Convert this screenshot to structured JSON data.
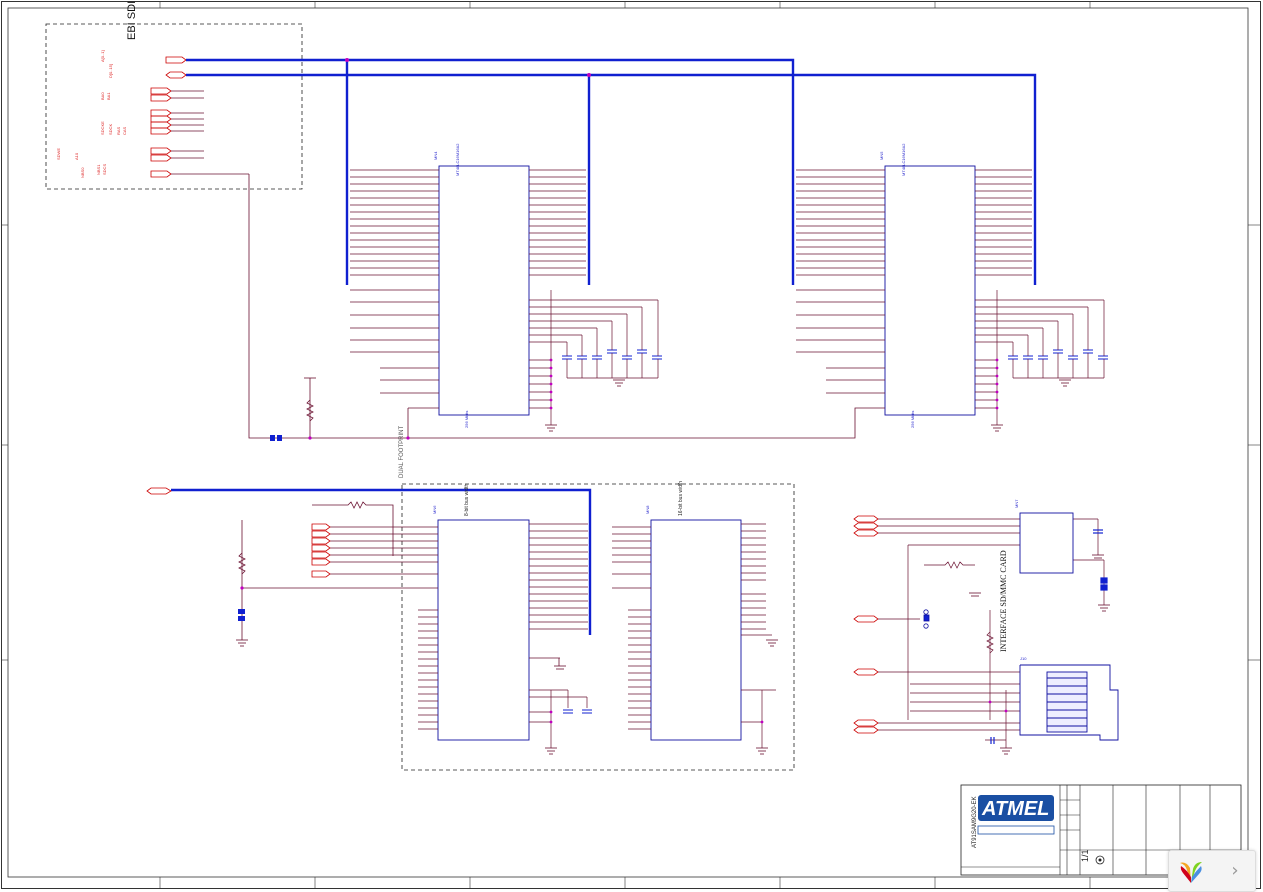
{
  "sheet": {
    "frame_columns": [
      "1",
      "2",
      "3",
      "4",
      "5",
      "6",
      "7",
      "8"
    ],
    "frame_rows": [
      "A",
      "B",
      "C",
      "D"
    ]
  },
  "blocks": {
    "ebi_group": "EBI SDI",
    "ebi_signals": [
      "A[0..1]",
      "D[0..15]",
      "BA0",
      "BA1",
      "SDCKE",
      "SDCK",
      "RAS",
      "CAS",
      "SDWE",
      "A10",
      "NBS0",
      "NBS1",
      "SDCS"
    ],
    "ebi_right_labels": [
      "EBI_D[0..15]",
      "EBI_A[2..15]"
    ],
    "sdram_part_name": "MT48LC16M16A2",
    "sdram1_ref": "MN4",
    "sdram2_ref": "MN5",
    "sdram_size_label": "256 Mbits",
    "dual_footprint": "DUAL FOOTPRINT",
    "nand_group_label": "8-bit bus width",
    "nand2_label": "16-bit bus width",
    "nand1_ref": "MN6",
    "nand2_ref": "MN8",
    "card_label": "INTERFACE SD/MMC CARD",
    "card_ref": "J10",
    "card_ic_ref": "MN7"
  },
  "title_block": {
    "company_logo_text": "ATMEL",
    "board_name": "AT91SAM9G20-EK",
    "sheet_number": "1/1"
  },
  "viewer": {
    "next_glyph": "›"
  },
  "colors": {
    "wire": "#6a1030",
    "bus": "#1020d0",
    "pin_text": "#dd2222",
    "junction": "#c000c0",
    "component": "#1010a0"
  }
}
